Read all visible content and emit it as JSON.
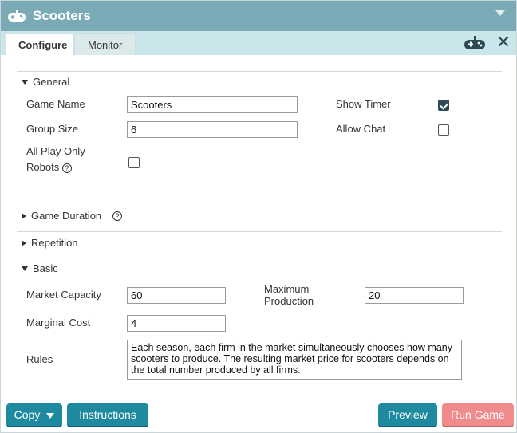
{
  "window": {
    "title": "Scooters"
  },
  "tabs": [
    {
      "label": "Configure",
      "active": true
    },
    {
      "label": "Monitor",
      "active": false
    }
  ],
  "general": {
    "heading": "General",
    "game_name_label": "Game Name",
    "game_name_value": "Scooters",
    "group_size_label": "Group Size",
    "group_size_value": "6",
    "all_play_label_line1": "All Play Only",
    "all_play_label_line2": "Robots",
    "show_timer_label": "Show Timer",
    "show_timer_checked": true,
    "allow_chat_label": "Allow Chat",
    "allow_chat_checked": false,
    "all_play_checked": false
  },
  "sections": {
    "game_duration": "Game Duration",
    "repetition": "Repetition"
  },
  "basic": {
    "heading": "Basic",
    "market_capacity_label": "Market Capacity",
    "market_capacity_value": "60",
    "maximum_production_label_line1": "Maximum",
    "maximum_production_label_line2": "Production",
    "maximum_production_value": "20",
    "marginal_cost_label": "Marginal Cost",
    "marginal_cost_value": "4",
    "rules_label": "Rules",
    "rules_value": "Each season, each firm in the market simultaneously chooses how many scooters to produce. The resulting market price for scooters depends on the total number produced by all firms."
  },
  "footer": {
    "copy_label": "Copy",
    "instructions_label": "Instructions",
    "preview_label": "Preview",
    "run_game_label": "Run Game"
  },
  "colors": {
    "titlebar": "#7aaab5",
    "tabbar": "#c9e6ea",
    "button_teal": "#1d8aa0",
    "button_coral": "#f08b8b",
    "checkbox_checked": "#2e4b57"
  },
  "icons": {
    "app": "gamepad-icon",
    "tab_right": "gamepad-icon",
    "close": "close-icon",
    "help": "help-icon"
  }
}
